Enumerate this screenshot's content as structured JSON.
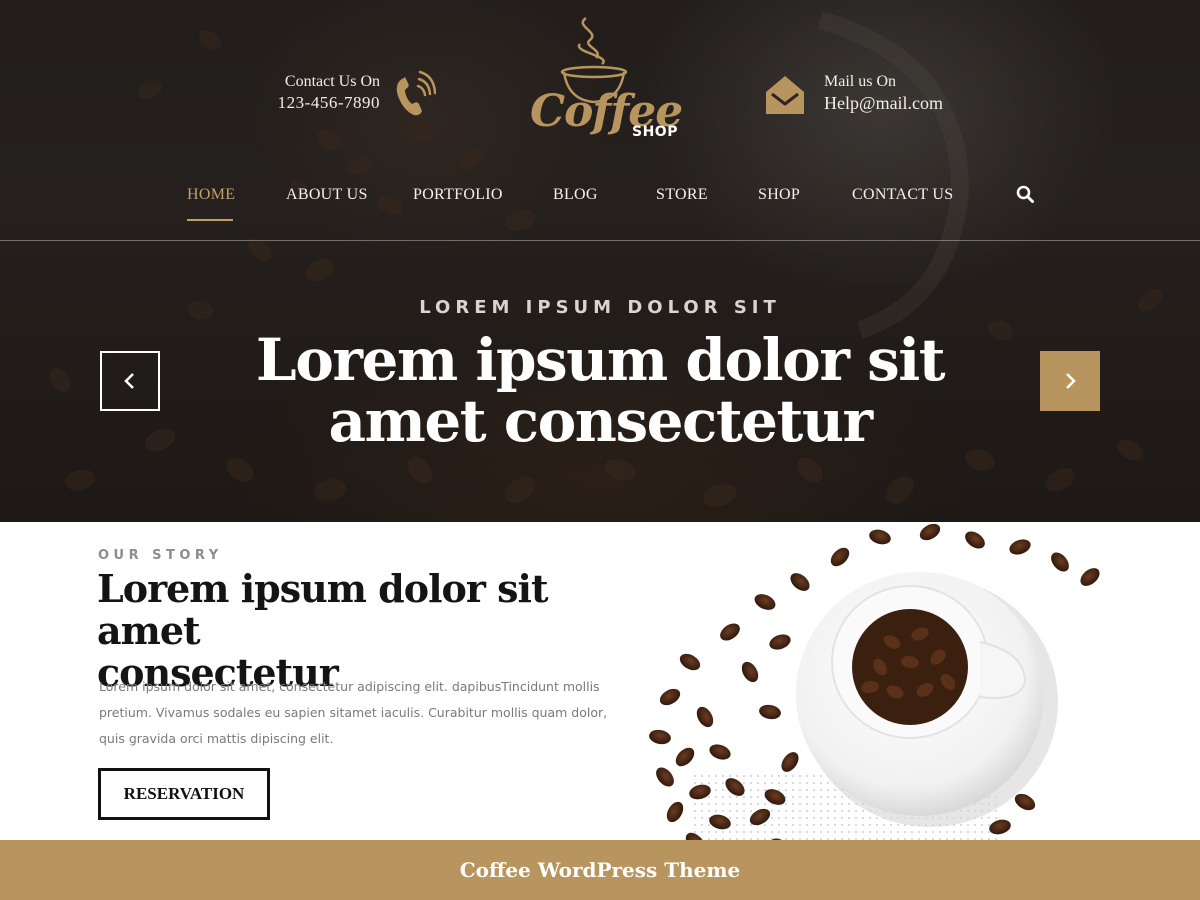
{
  "header": {
    "contact": {
      "label": "Contact Us On",
      "phone": "123-456-7890",
      "icon": "phone-icon"
    },
    "logo": {
      "word": "Coffee",
      "sub": "SHOP"
    },
    "mail": {
      "label": "Mail us On",
      "email": "Help@mail.com",
      "icon": "envelope-icon"
    }
  },
  "nav": {
    "items": [
      {
        "label": "HOME",
        "active": true
      },
      {
        "label": "ABOUT US",
        "active": false
      },
      {
        "label": "PORTFOLIO",
        "active": false
      },
      {
        "label": "BLOG",
        "active": false
      },
      {
        "label": "STORE",
        "active": false
      },
      {
        "label": "SHOP",
        "active": false
      },
      {
        "label": "CONTACT US",
        "active": false
      }
    ],
    "search_icon": "search-icon"
  },
  "hero": {
    "kicker": "LOREM IPSUM DOLOR SIT",
    "title_line1": "Lorem ipsum dolor sit",
    "title_line2": "amet consectetur",
    "prev_icon": "chevron-left-icon",
    "next_icon": "chevron-right-icon"
  },
  "story": {
    "kicker": "OUR STORY",
    "title_line1": "Lorem ipsum dolor sit amet",
    "title_line2": "consectetur",
    "text": "Lorem ipsum dolor sit amet, consectetur adipiscing elit. dapibusTincidunt mollis pretium. Vivamus sodales eu sapien sitamet iaculis. Curabitur mollis quam dolor, quis gravida orci mattis dipiscing elit.",
    "button": "RESERVATION"
  },
  "footer": {
    "text": "Coffee WordPress Theme"
  },
  "colors": {
    "accent": "#b8955e",
    "dark": "#2b2624",
    "text": "#141414",
    "muted": "#7a7a7a"
  }
}
